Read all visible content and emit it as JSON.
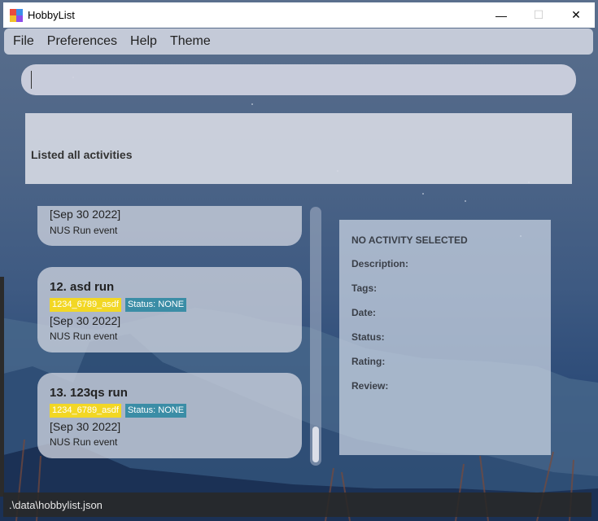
{
  "window": {
    "title": "HobbyList",
    "minimize": "—",
    "maximize": "☐",
    "close": "✕"
  },
  "menu": [
    "File",
    "Preferences",
    "Help",
    "Theme"
  ],
  "command": {
    "value": "",
    "placeholder": ""
  },
  "result": {
    "message": "Listed all activities"
  },
  "list": {
    "partial_card": {
      "date": "[Sep 30 2022]",
      "description": "NUS Run event"
    },
    "cards": [
      {
        "index_name": "12.  asd run",
        "tag": "1234_6789_asdf",
        "status": "Status: NONE",
        "date": "[Sep 30 2022]",
        "description": "NUS Run event"
      },
      {
        "index_name": "13.  123qs run",
        "tag": "1234_6789_asdf",
        "status": "Status: NONE",
        "date": "[Sep 30 2022]",
        "description": "NUS Run event"
      }
    ]
  },
  "detail": {
    "header": "NO ACTIVITY SELECTED",
    "description_label": "Description:",
    "tags_label": "Tags:",
    "date_label": "Date:",
    "status_label": "Status:",
    "rating_label": "Rating:",
    "review_label": "Review:"
  },
  "statusbar": {
    "path": ".\\data\\hobbylist.json"
  },
  "colors": {
    "tag": "#f2d724",
    "status_tag": "#3b8da6"
  }
}
